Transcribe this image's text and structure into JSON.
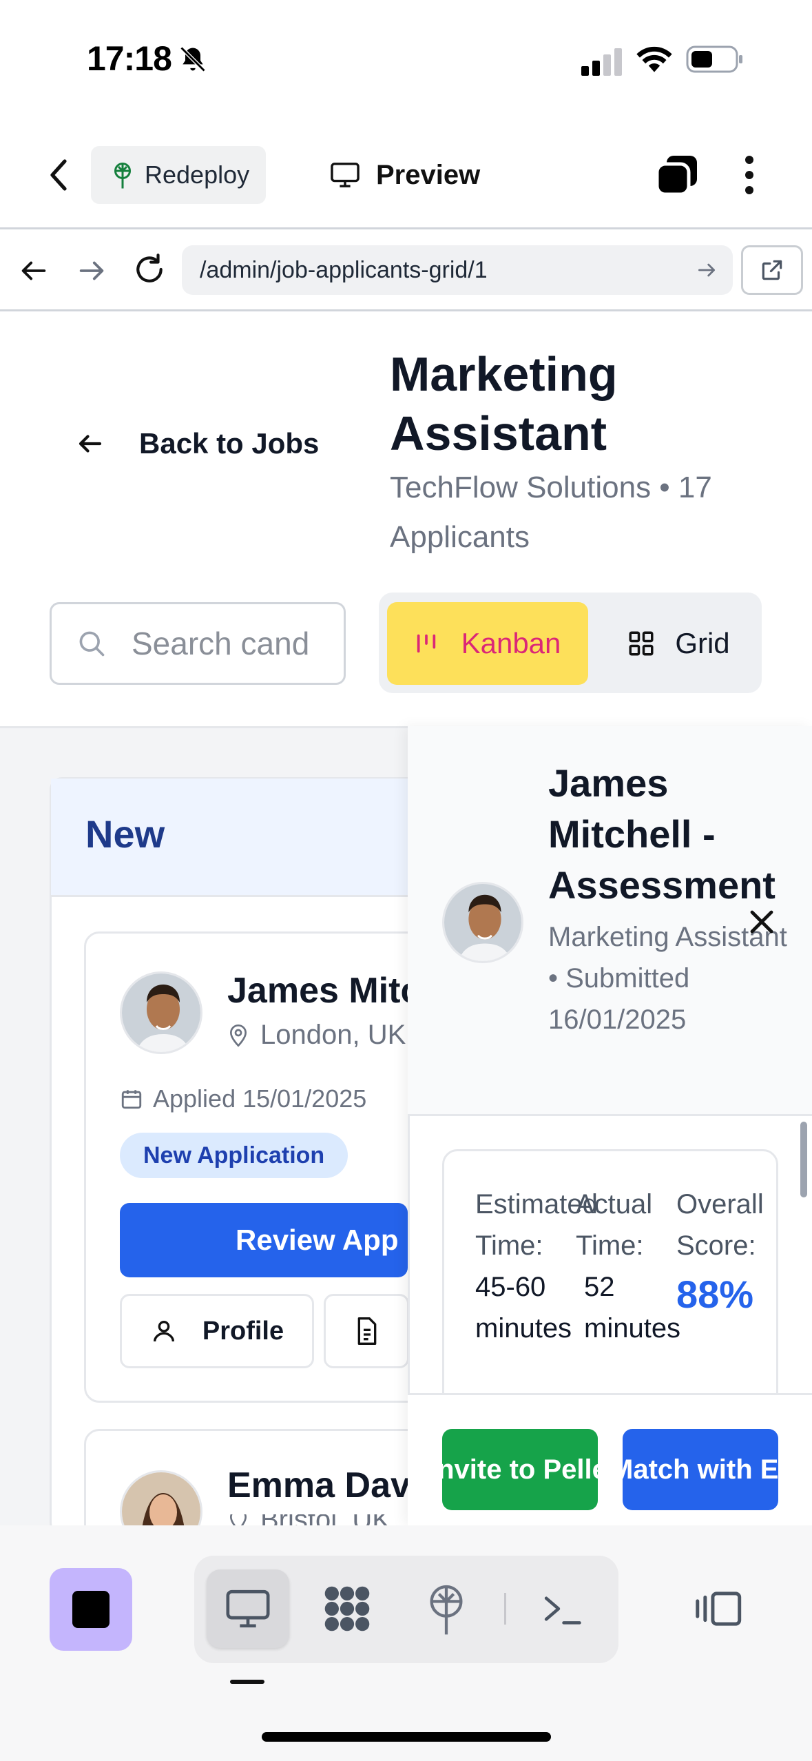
{
  "status_bar": {
    "time": "17:18"
  },
  "app_toolbar": {
    "redeploy_label": "Redeploy",
    "preview_label": "Preview"
  },
  "browser": {
    "url": "/admin/job-applicants-grid/1"
  },
  "page": {
    "back_label": "Back to Jobs",
    "job_title": "Marketing Assistant",
    "company_line": "TechFlow Solutions • 17 Applicants",
    "search_placeholder": "Search cand",
    "view_toggle": {
      "kanban": "Kanban",
      "grid": "Grid",
      "selected": "Kanban"
    }
  },
  "board": {
    "column_title": "New",
    "cards": [
      {
        "name": "James Mitc",
        "location": "London, UK",
        "applied": "Applied 15/01/2025",
        "status": "New Application",
        "review_label": "Review App",
        "profile_label": "Profile"
      },
      {
        "name": "Emma Davi",
        "location": "Bristol, UK"
      }
    ]
  },
  "panel": {
    "title": "James Mitchell - Assessment",
    "subtitle": "Marketing Assistant • Submitted 16/01/2025",
    "estimated_label": "Estimated Time:",
    "estimated_value": "45-60 minutes",
    "actual_label": "Actual Time:",
    "actual_value": "52 minutes",
    "score_label": "Overall Score:",
    "score_value": "88%",
    "move_label": "Invite to Pellem",
    "match_label": "Match with Emp"
  },
  "colors": {
    "accent_blue": "#2563eb",
    "kanban_active_bg": "#fde05a",
    "kanban_active_text": "#db2777",
    "green": "#16a34a",
    "stop_bg": "#c4b5fd"
  }
}
